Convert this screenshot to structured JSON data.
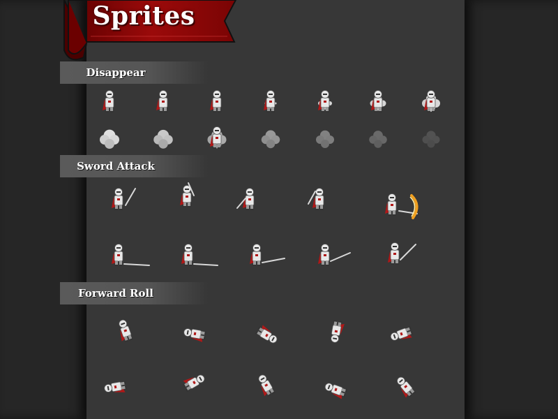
{
  "banner": {
    "title": "Sprites",
    "color": "#8b0000"
  },
  "sections": [
    {
      "label": "Disappear",
      "frame_count": 14
    },
    {
      "label": "Sword Attack",
      "frame_count": 10
    },
    {
      "label": "Forward Roll",
      "frame_count": 10
    }
  ],
  "colors": {
    "background": "#2d2d2d",
    "sheet": "#373737",
    "knight_armor": "#e8e8e8",
    "knight_cape": "#b01818",
    "sword": "#d8d8d8",
    "slash": "#f0a020"
  }
}
